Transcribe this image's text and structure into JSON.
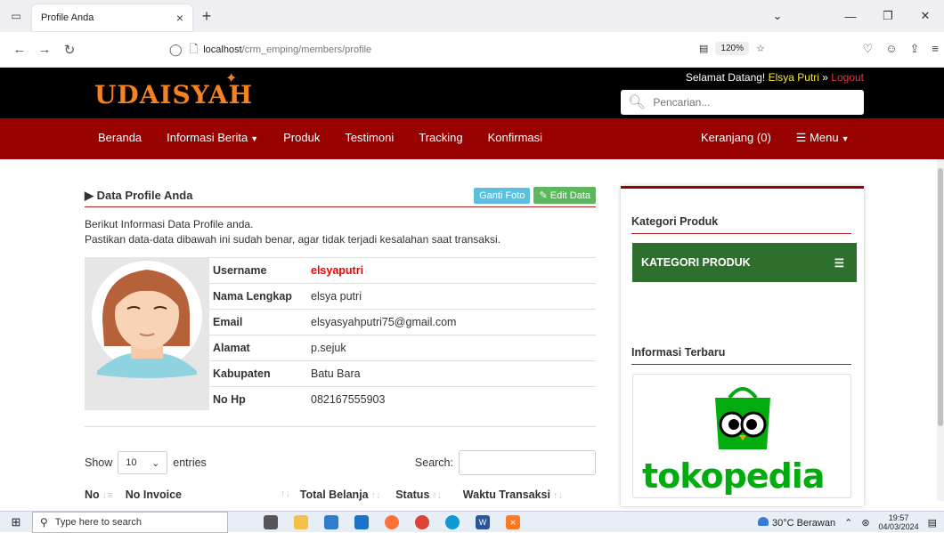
{
  "browser": {
    "tab_title": "Profile Anda",
    "tab_close": "×",
    "new_tab": "+",
    "url_host": "localhost",
    "url_path": "/crm_emping/members/profile",
    "zoom": "120%"
  },
  "site": {
    "logo": "UDAISYAH",
    "welcome_prefix": "Selamat Datang! ",
    "welcome_user": "Elsya Putri",
    "welcome_sep": " » ",
    "logout": "Logout",
    "search_placeholder": "Pencarian..."
  },
  "nav": {
    "beranda": "Beranda",
    "informasi": "Informasi Berita",
    "produk": "Produk",
    "testimoni": "Testimoni",
    "tracking": "Tracking",
    "konfirmasi": "Konfirmasi",
    "keranjang": "Keranjang (0)",
    "menu": "Menu"
  },
  "profile": {
    "heading": "Data Profile Anda",
    "ganti_foto": "Ganti Foto",
    "edit_data": "Edit Data",
    "intro_line1": "Berikut Informasi Data Profile anda.",
    "intro_line2": "Pastikan data-data dibawah ini sudah benar, agar tidak terjadi kesalahan saat transaksi.",
    "fields": [
      {
        "label": "Username",
        "value": "elsyaputri"
      },
      {
        "label": "Nama Lengkap",
        "value": "elsya putri"
      },
      {
        "label": "Email",
        "value": "elsyasyahputri75@gmail.com"
      },
      {
        "label": "Alamat",
        "value": "p.sejuk"
      },
      {
        "label": "Kabupaten",
        "value": "Batu Bara"
      },
      {
        "label": "No Hp",
        "value": "082167555903"
      }
    ]
  },
  "table": {
    "show": "Show",
    "entries_value": "10",
    "entries": "entries",
    "search_label": "Search:",
    "columns": [
      "No",
      "No Invoice",
      "Total Belanja",
      "Status",
      "Waktu Transaksi"
    ]
  },
  "sidebar": {
    "kategori_head": "Kategori Produk",
    "kategori_bar": "KATEGORI PRODUK",
    "info_head": "Informasi Terbaru",
    "promo_text": "tokopedia"
  },
  "taskbar": {
    "search_placeholder": "Type here to search",
    "weather": "30°C  Berawan",
    "time": "19:57",
    "date": "04/03/2024"
  }
}
